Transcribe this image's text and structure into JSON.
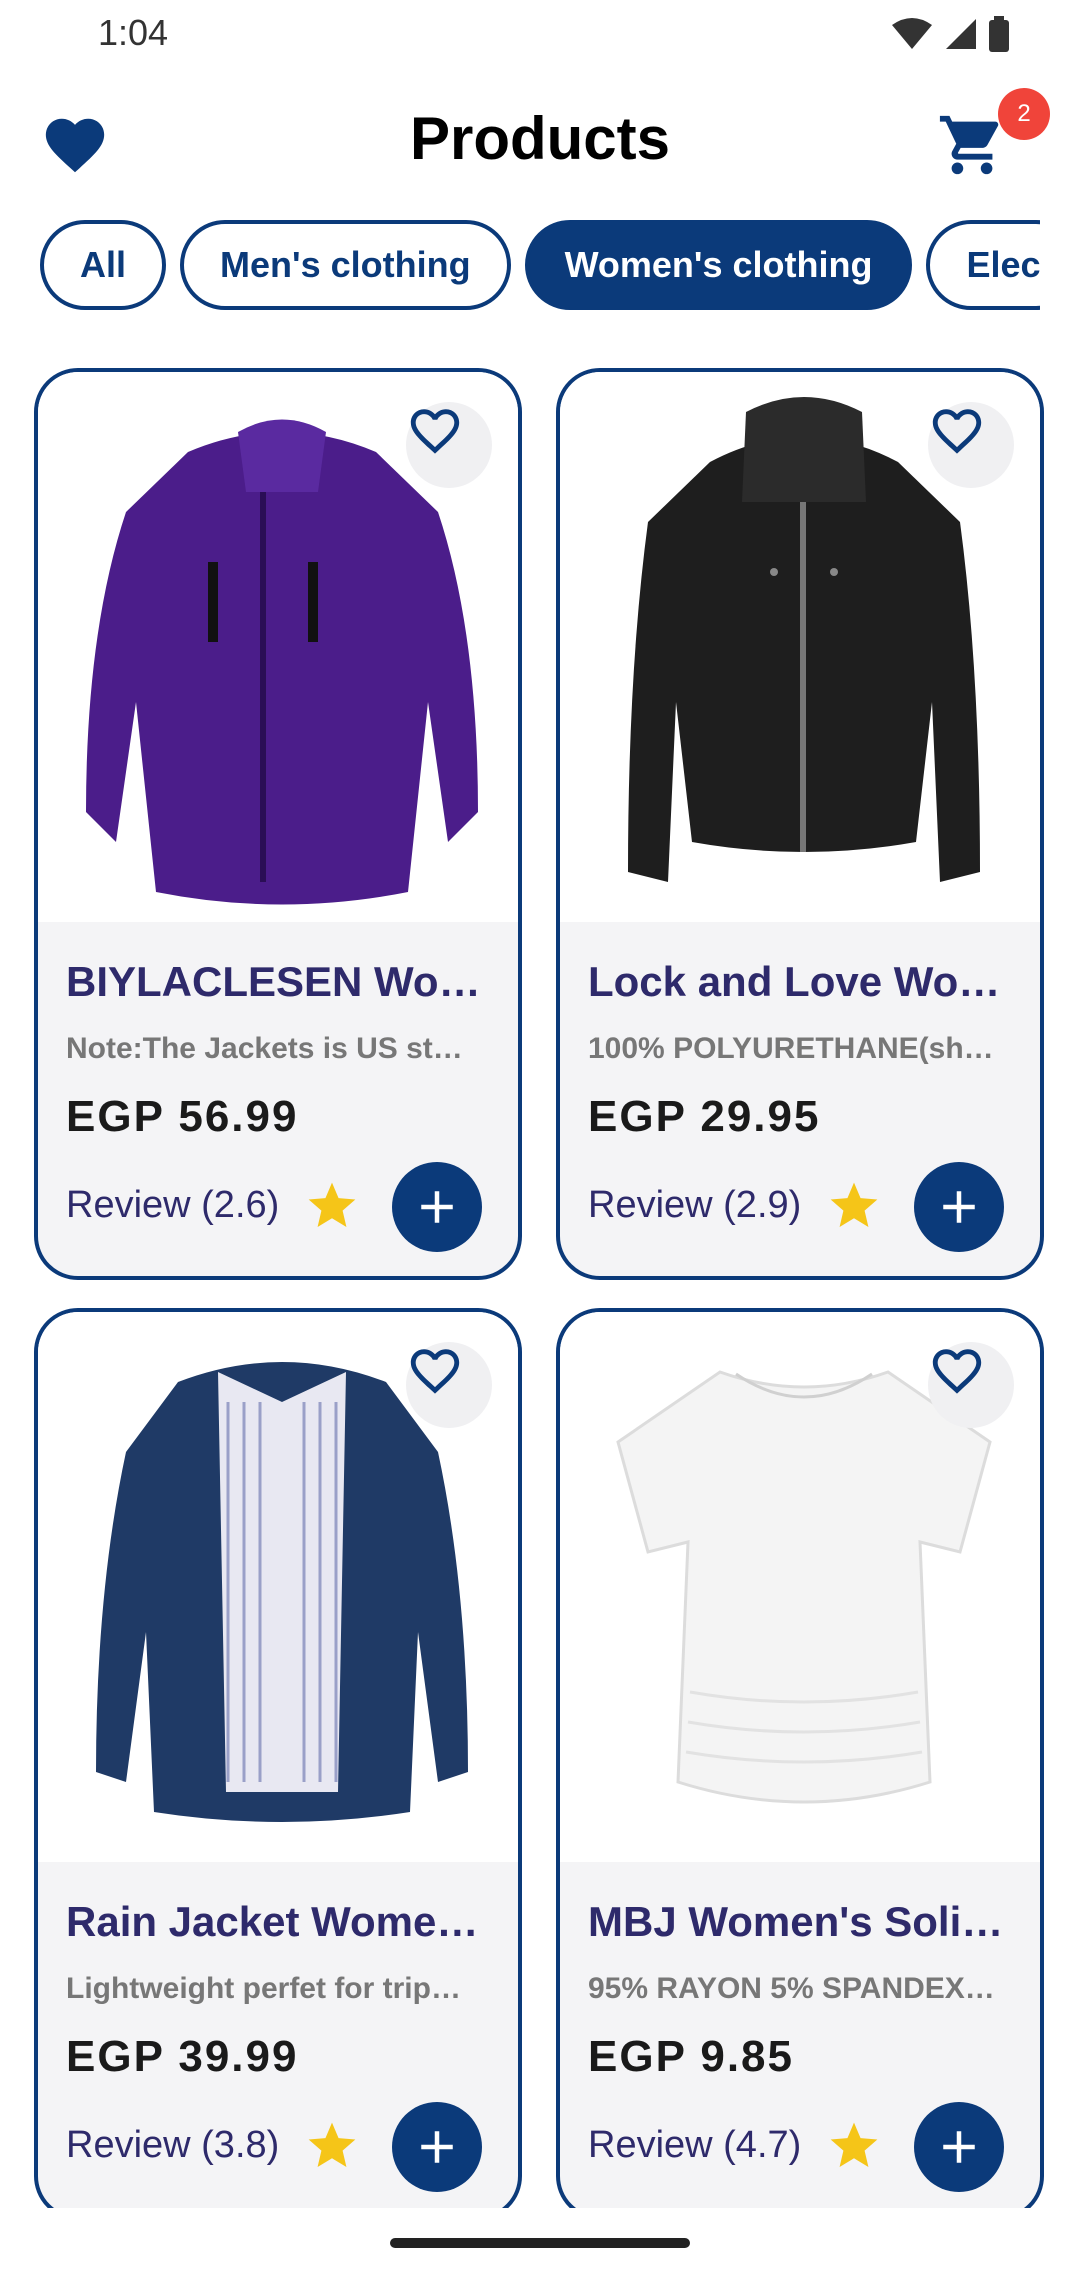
{
  "status_bar": {
    "time": "1:04"
  },
  "app_bar": {
    "title": "Products",
    "cart_count": "2"
  },
  "categories": [
    {
      "label": "All",
      "active": false
    },
    {
      "label": "Men's clothing",
      "active": false
    },
    {
      "label": "Women's clothing",
      "active": true
    },
    {
      "label": "Elec",
      "active": false
    }
  ],
  "products": [
    {
      "title": "BIYLACLESEN Wo…",
      "description": "Note:The Jackets is US st…",
      "price": "EGP 56.99",
      "review": "Review (2.6)",
      "image": "purple-jacket"
    },
    {
      "title": "Lock and Love Wo…",
      "description": "100% POLYURETHANE(sh…",
      "price": "EGP 29.95",
      "review": "Review (2.9)",
      "image": "black-leather-jacket"
    },
    {
      "title": "Rain Jacket Wome…",
      "description": "Lightweight perfet for trip…",
      "price": "EGP 39.99",
      "review": "Review (3.8)",
      "image": "navy-rain-jacket"
    },
    {
      "title": "MBJ Women's Soli…",
      "description": "95% RAYON 5% SPANDEX…",
      "price": "EGP 9.85",
      "review": "Review (4.7)",
      "image": "white-top"
    }
  ],
  "colors": {
    "primary": "#0b3a7a",
    "badge": "#f0443a",
    "star": "#f5c518",
    "title": "#2e2a6b"
  },
  "icons": [
    "heart-icon",
    "cart-icon",
    "wishlist-heart-icon",
    "star-icon",
    "plus-icon",
    "wifi-icon",
    "signal-icon",
    "battery-icon"
  ]
}
